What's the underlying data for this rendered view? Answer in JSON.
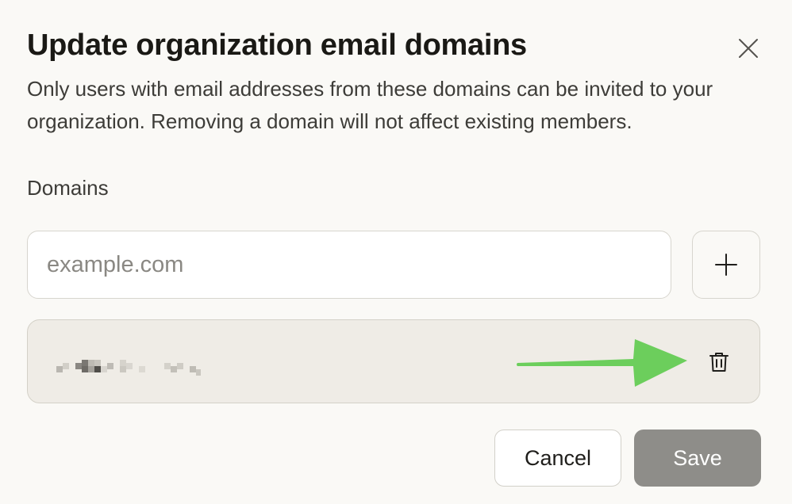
{
  "dialog": {
    "title": "Update organization email domains",
    "description": "Only users with email addresses from these domains can be invited to your organization. Removing a domain will not affect existing members.",
    "close_icon": "close-icon"
  },
  "domains": {
    "label": "Domains",
    "input_placeholder": "example.com",
    "input_value": "",
    "add_icon": "plus-icon",
    "items": [
      {
        "value_redacted": true,
        "delete_icon": "trash-icon"
      }
    ]
  },
  "annotation": {
    "arrow_color": "#6cce5c"
  },
  "footer": {
    "cancel_label": "Cancel",
    "save_label": "Save"
  },
  "colors": {
    "background": "#faf9f6",
    "row_background": "#efece6",
    "save_disabled": "#8e8d89"
  }
}
